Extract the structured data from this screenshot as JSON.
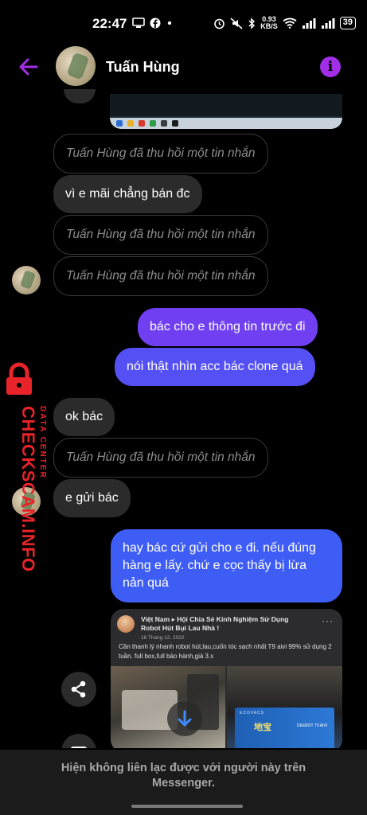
{
  "status_bar": {
    "time": "22:47",
    "net_speed_value": "0.93",
    "net_speed_unit": "KB/S",
    "battery": "39"
  },
  "header": {
    "contact_name": "Tuấn Hùng"
  },
  "messages": [
    {
      "type": "recalled",
      "text": "Tuấn Hùng đã thu hồi một tin nhắn"
    },
    {
      "type": "incoming",
      "text": "vì e mãi chẳng bán đc"
    },
    {
      "type": "recalled",
      "text": "Tuấn Hùng đã thu hồi một tin nhắn"
    },
    {
      "type": "recalled",
      "text": "Tuấn Hùng đã thu hồi một tin nhắn"
    },
    {
      "type": "outgoing",
      "text": "bác cho e thông tin trước đi"
    },
    {
      "type": "outgoing",
      "text": "nói thật nhìn acc bác clone quá"
    },
    {
      "type": "incoming",
      "text": "ok bác"
    },
    {
      "type": "recalled",
      "text": "Tuấn Hùng đã thu hồi một tin nhắn"
    },
    {
      "type": "incoming",
      "text": "e gửi bác"
    },
    {
      "type": "outgoing",
      "text": "hay bác cứ gửi cho e đi. nếu đúng hàng e lấy. chứ e cọc thấy bị lừa nản quá"
    }
  ],
  "shared_post": {
    "group_path": "Việt Nam ▸ Hội Chia Sẻ Kinh Nghiệm Sử Dụng Robot Hút Bụi Lau Nhà !",
    "date": "16 Tháng 12, 2022 · ",
    "body": "Cần thanh lý nhanh robot hút,lau,cuốn tóc sạch nhất T9 aivi 99% sử dụng 2 tuần. full box,full bảo hành,giá 3.x",
    "box_label": "地宝",
    "box_brand": "ECOVACS",
    "box_model": "DEEBOT T9 AIVI"
  },
  "watermark": {
    "main": "CHECKSCAM.INFO",
    "sub": "DATA CENTER"
  },
  "footer": {
    "notice": "Hiện không liên lạc được với người này trên Messenger."
  },
  "colors": {
    "accent": "#9b2ff0",
    "out_top": "#7a3cf2",
    "out_bottom": "#3b5ef5",
    "incoming": "#2b2b2b",
    "watermark": "#e8232a"
  }
}
